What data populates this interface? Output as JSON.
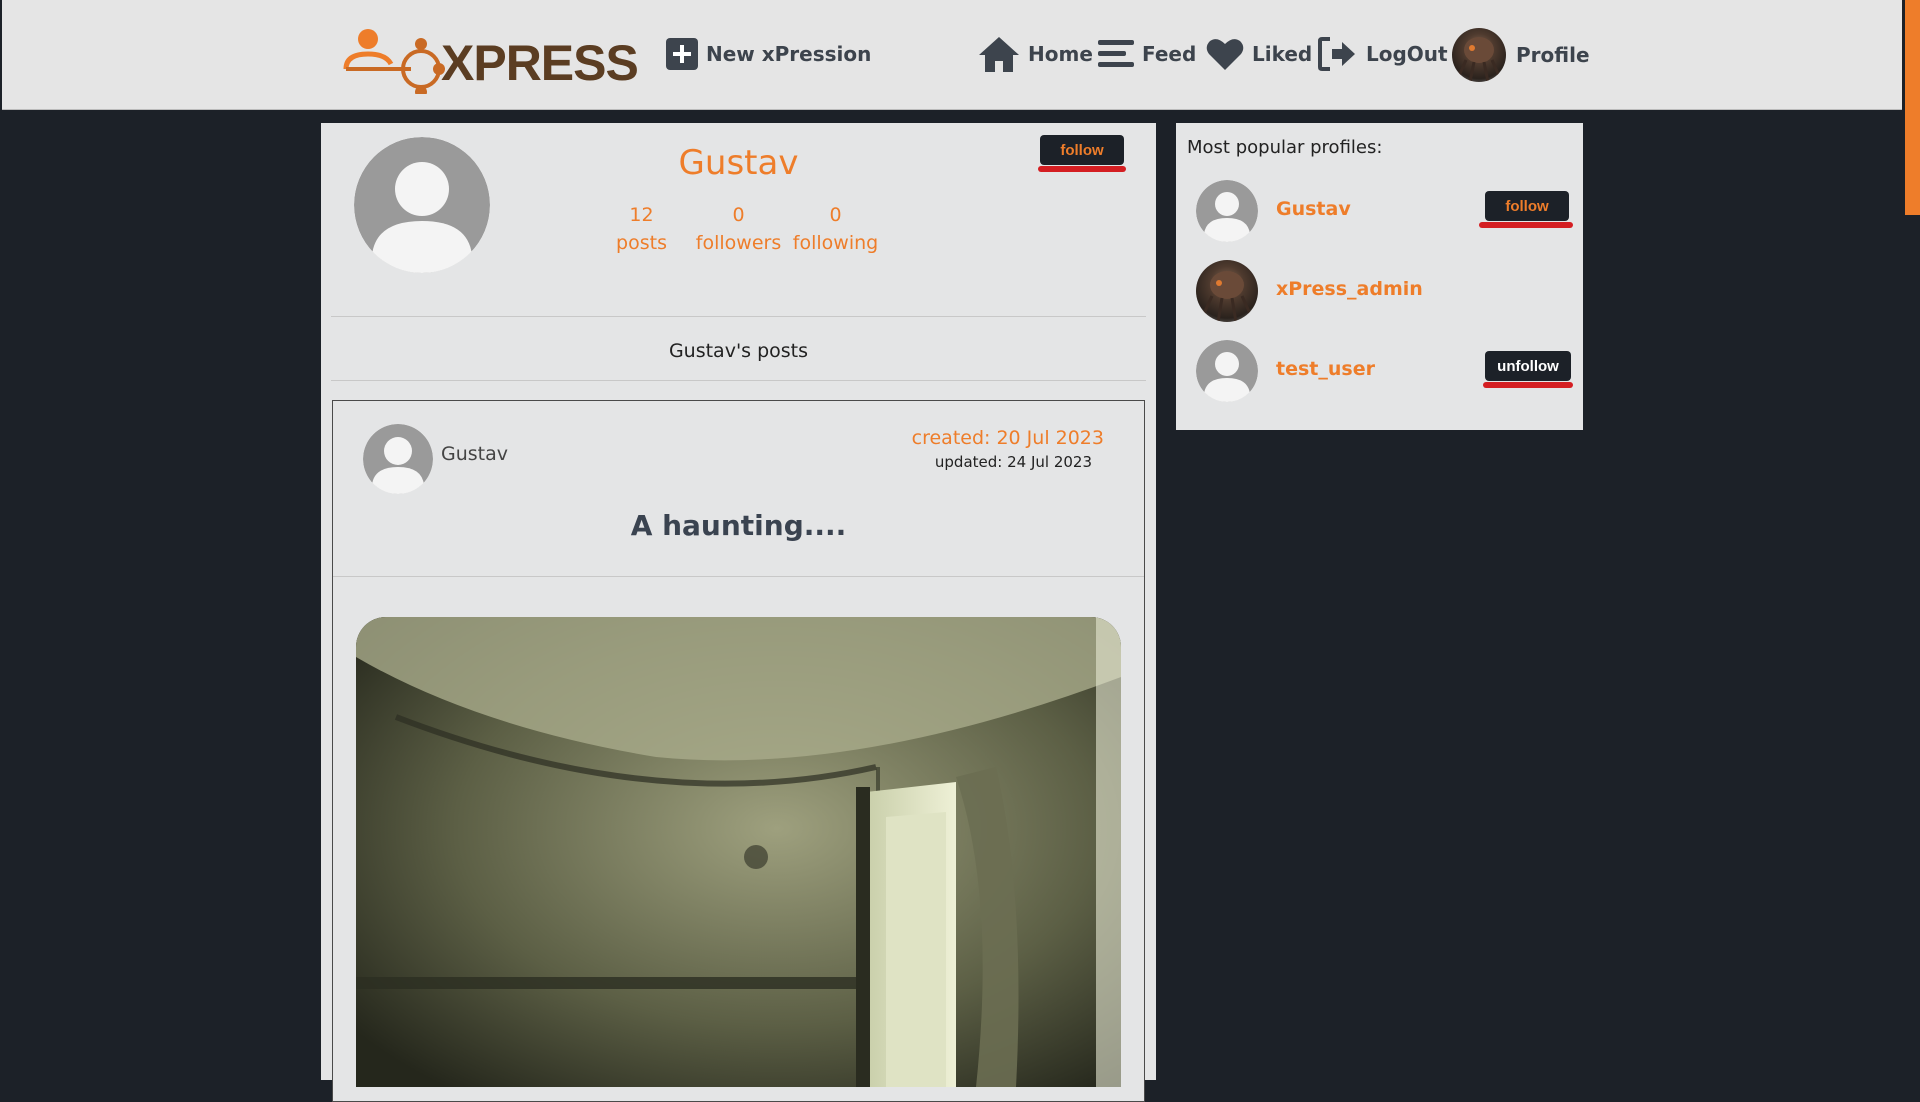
{
  "nav": {
    "brand": "XPRESS",
    "new_label": "New xPression",
    "home_label": "Home",
    "feed_label": "Feed",
    "liked_label": "Liked",
    "logout_label": "LogOut",
    "profile_label": "Profile"
  },
  "profile": {
    "name": "Gustav",
    "follow_label": "follow",
    "stats": [
      {
        "value": "12",
        "label": "posts"
      },
      {
        "value": "0",
        "label": "followers"
      },
      {
        "value": "0",
        "label": "following"
      }
    ],
    "posts_heading": "Gustav's posts"
  },
  "post": {
    "author": "Gustav",
    "created": "created: 20 Jul 2023",
    "updated": "updated: 24 Jul 2023",
    "title": "A haunting...."
  },
  "sidebar": {
    "title": "Most popular profiles:",
    "profiles": [
      {
        "name": "Gustav",
        "button": "follow"
      },
      {
        "name": "xPress_admin",
        "button": ""
      },
      {
        "name": "test_user",
        "button": "unfollow"
      }
    ]
  },
  "colors": {
    "accent": "#ee7d2a",
    "dark": "#1c2128",
    "underline": "#d41e22",
    "panel": "#e4e5e6"
  }
}
